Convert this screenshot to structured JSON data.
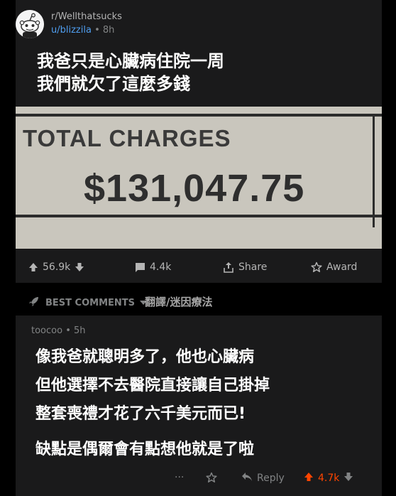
{
  "post": {
    "subreddit": "r/Wellthatsucks",
    "author": "u/blizzila",
    "separator": "•",
    "age": "8h",
    "title_line1": "我爸只是心臟病住院一周",
    "title_line2": "我們就欠了這麼多錢",
    "image": {
      "label": "TOTAL CHARGES",
      "amount": "$131,047.75"
    },
    "actions": {
      "upvotes": "56.9k",
      "comments": "4.4k",
      "share": "Share",
      "award": "Award"
    }
  },
  "comments_header": {
    "sort_label": "BEST COMMENTS",
    "translator": "翻譯/迷因療法"
  },
  "comment": {
    "author": "toocoo",
    "separator": "•",
    "age": "5h",
    "line1": "像我爸就聰明多了，他也心臟病",
    "line2": "但他選擇不去醫院直接讓自己掛掉",
    "line3": "整套喪禮才花了六千美元而已!",
    "line4": "缺點是偶爾會有點想他就是了啦",
    "more": "···",
    "reply": "Reply",
    "score": "4.7k"
  },
  "colors": {
    "card_bg": "#1a1a1b",
    "username_blue": "#4f9ef0",
    "upvoted_orange": "#ff4500",
    "paper": "#c9c6bd"
  }
}
